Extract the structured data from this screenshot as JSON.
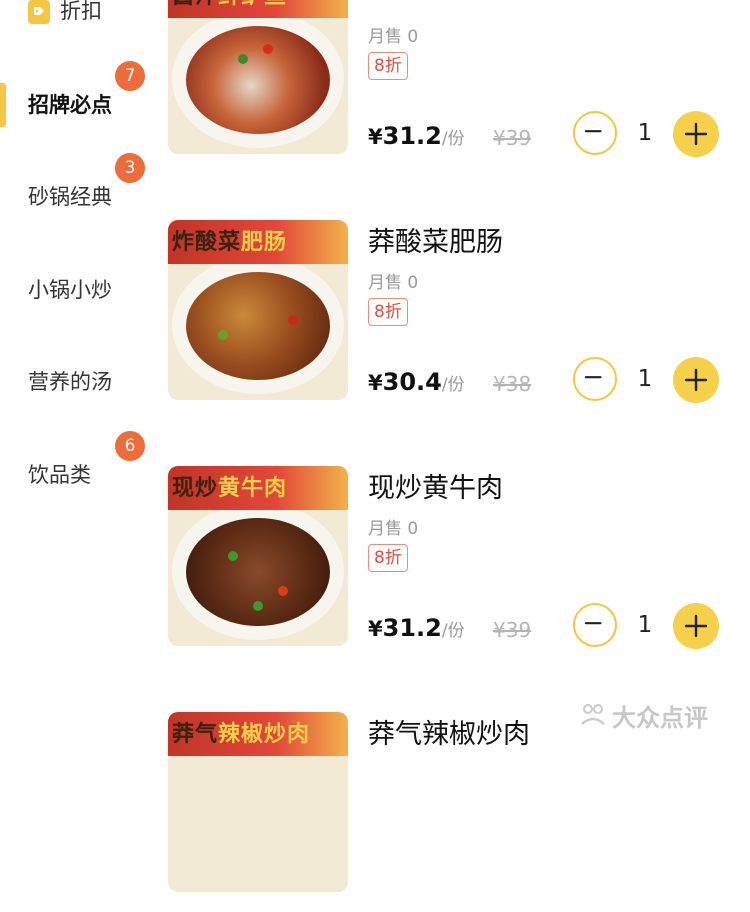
{
  "sidebar": {
    "discount": {
      "label": "折扣"
    },
    "categories": [
      {
        "label": "招牌必点",
        "badge": "7",
        "active": true
      },
      {
        "label": "砂锅经典",
        "badge": "3"
      },
      {
        "label": "小锅小炒",
        "badge": ""
      },
      {
        "label": "营养的汤",
        "badge": ""
      },
      {
        "label": "饮品类",
        "badge": "6"
      }
    ]
  },
  "items": [
    {
      "name": "",
      "sold": "月售 0",
      "discount": "8折",
      "currency": "¥",
      "price": "31.2",
      "unit": "/份",
      "original": "¥39",
      "quantity": "1",
      "banner": {
        "plain": "酱汁",
        "highlight": "鲜鲈鱼"
      }
    },
    {
      "name": "莽酸菜肥肠",
      "sold": "月售 0",
      "discount": "8折",
      "currency": "¥",
      "price": "30.4",
      "unit": "/份",
      "original": "¥38",
      "quantity": "1",
      "banner": {
        "plain": "炸酸菜",
        "highlight": "肥肠"
      }
    },
    {
      "name": "现炒黄牛肉",
      "sold": "月售 0",
      "discount": "8折",
      "currency": "¥",
      "price": "31.2",
      "unit": "/份",
      "original": "¥39",
      "quantity": "1",
      "banner": {
        "plain": "现炒",
        "highlight": "黄牛肉"
      }
    },
    {
      "name": "莽气辣椒炒肉",
      "banner": {
        "plain": "莽气",
        "highlight": "辣椒炒肉"
      }
    }
  ],
  "watermark": {
    "text": "大众点评"
  },
  "colors": {
    "accent": "#f5c63f",
    "badge": "#ee6b3a",
    "discount": "#e84b3c"
  }
}
